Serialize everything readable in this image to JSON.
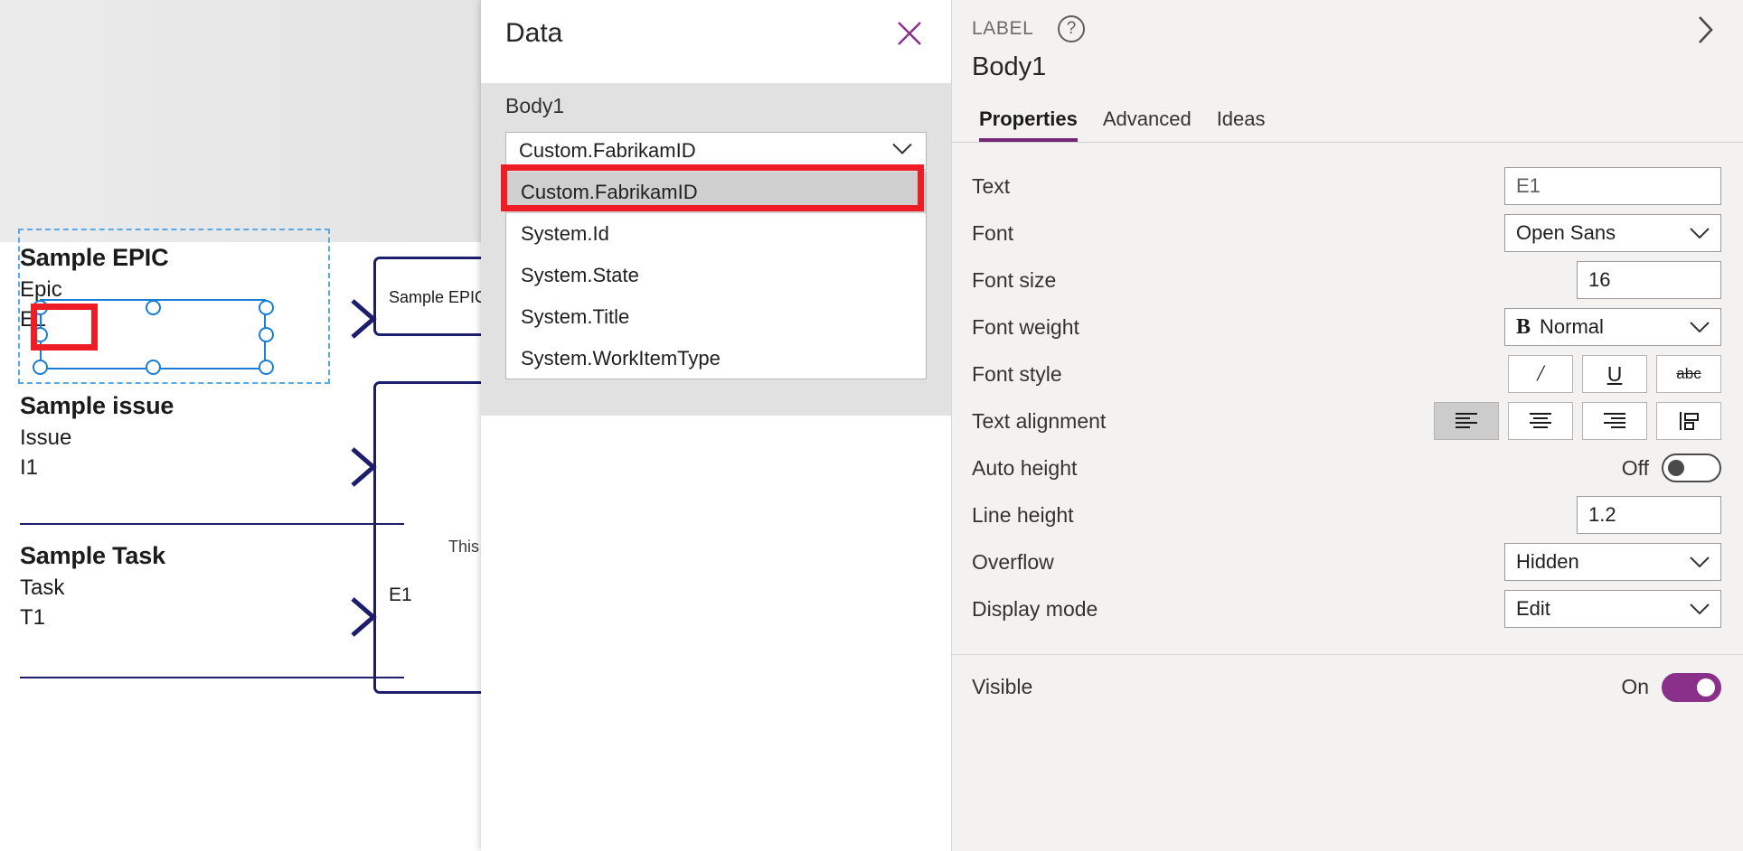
{
  "canvas": {
    "gallery": {
      "items": [
        {
          "title": "Sample EPIC",
          "type": "Epic",
          "id": "E1"
        },
        {
          "title": "Sample issue",
          "type": "Issue",
          "id": "I1"
        },
        {
          "title": "Sample Task",
          "type": "Task",
          "id": "T1"
        }
      ],
      "chevron_icon": "chevron-right-icon"
    },
    "detail_cards": [
      {
        "text": "Sample EPIC"
      },
      {
        "text": "This fo"
      },
      {
        "text": "E1"
      }
    ]
  },
  "data_panel": {
    "title": "Data",
    "close_icon": "close-icon",
    "field_label": "Body1",
    "selected_value": "Custom.FabrikamID",
    "dropdown_icon": "chevron-down-icon",
    "options": [
      "Custom.FabrikamID",
      "System.Id",
      "System.State",
      "System.Title",
      "System.WorkItemType"
    ],
    "highlighted_option_index": 0
  },
  "properties_panel": {
    "kicker": "LABEL",
    "help_icon": "help-circle-icon",
    "expand_icon": "chevron-right-icon",
    "control_name": "Body1",
    "tabs": [
      {
        "label": "Properties",
        "active": true
      },
      {
        "label": "Advanced",
        "active": false
      },
      {
        "label": "Ideas",
        "active": false
      }
    ],
    "rows": {
      "text": {
        "label": "Text",
        "value": "E1"
      },
      "font": {
        "label": "Font",
        "value": "Open Sans"
      },
      "font_size": {
        "label": "Font size",
        "value": "16"
      },
      "font_weight": {
        "label": "Font weight",
        "value": "Normal",
        "prefix": "B"
      },
      "font_style": {
        "label": "Font style",
        "buttons": [
          {
            "icon": "italic-icon",
            "glyph": "/",
            "active": false
          },
          {
            "icon": "underline-icon",
            "glyph": "U",
            "active": false
          },
          {
            "icon": "strikethrough-icon",
            "glyph": "abc",
            "active": false
          }
        ]
      },
      "text_alignment": {
        "label": "Text alignment",
        "buttons": [
          {
            "icon": "align-left-icon",
            "active": true
          },
          {
            "icon": "align-center-icon",
            "active": false
          },
          {
            "icon": "align-right-icon",
            "active": false
          },
          {
            "icon": "align-justify-icon",
            "active": false
          }
        ]
      },
      "auto_height": {
        "label": "Auto height",
        "state": "Off",
        "on": false
      },
      "line_height": {
        "label": "Line height",
        "value": "1.2"
      },
      "overflow": {
        "label": "Overflow",
        "value": "Hidden"
      },
      "display_mode": {
        "label": "Display mode",
        "value": "Edit"
      },
      "visible": {
        "label": "Visible",
        "state": "On",
        "on": true
      }
    }
  },
  "colors": {
    "accent_purple": "#742774",
    "annotation_red": "#ee1c25",
    "selection_blue": "#1a7fd4",
    "card_navy": "#1d1d6e"
  }
}
